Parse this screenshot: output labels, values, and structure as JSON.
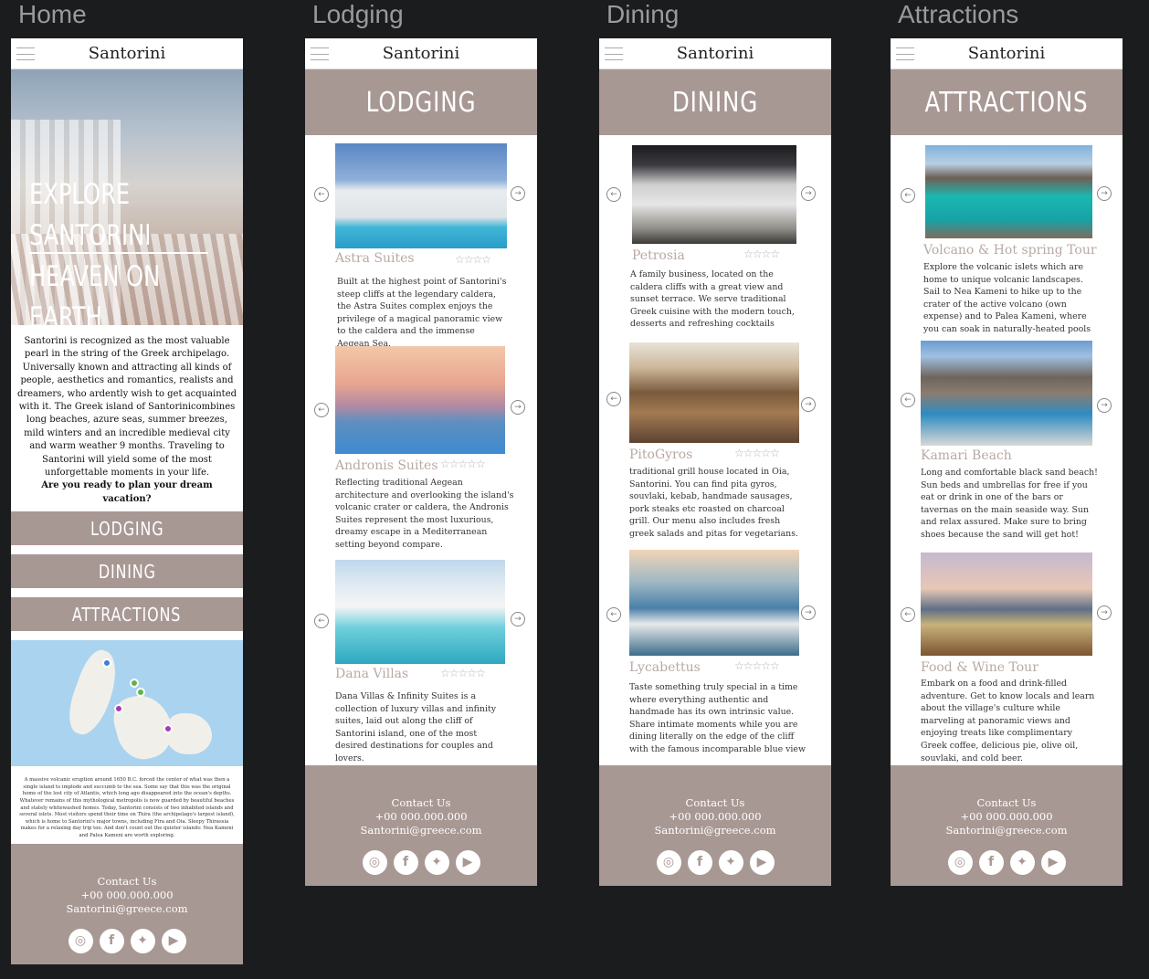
{
  "boards": {
    "home_label": "Home",
    "lodging_label": "Lodging",
    "dining_label": "Dining",
    "attractions_label": "Attractions"
  },
  "site": {
    "title": "Santorini"
  },
  "home": {
    "hero": [
      "EXPLORE",
      "SANTORINI",
      "HEAVEN ON EARTH"
    ],
    "intro": "Santorini is recognized as the most valuable pearl in the string of the Greek archipelago. Universally known and attracting all kinds of people, aesthetics and romantics, realists and dreamers, who ardently wish to get acquainted with it. The Greek island of Santorinicombines long  beaches, azure seas, summer breezes, mild winters and an incredible medieval city and warm weather 9 months. Traveling to Santorini will yield some of the most unforgettable moments in your life.",
    "question": "Are you ready to plan your dream vacation?",
    "nav": [
      "LODGING",
      "DINING",
      "ATTRACTIONS"
    ],
    "small_text": "A massive volcanic eruption around 1650 B.C. forced the center of what was then a single island to implode and succumb to the sea. Some say that this was the original home of the lost city of Atlantis, which long ago disappeared into the ocean's depths. Whatever remains of this mythological metropolis is now guarded by beautiful beaches and stately whitewashed homes. Today, Santorini consists of two inhabited islands and several islets. Most visitors spend their time on Thira (the archipelago's largest island), which is home to Santorini's major towns, including Fira and Oia. Sleepy Thirassia makes for a relaxing day trip too. And don't count out the quieter islands: Nea Kameni and Palea Kameni are worth exploring."
  },
  "footer": {
    "contact": "Contact Us",
    "phone": "+00 000.000.000",
    "email": "Santorini@greece.com"
  },
  "lodging": {
    "header": "LODGING",
    "items": [
      {
        "title": "Astra Suites",
        "stars": "☆☆☆☆",
        "desc": "Built at the highest point of Santorini's steep cliffs at the legendary caldera, the Astra Suites complex enjoys the privilege of a magical panoramic view to the caldera and the immense Aegean Sea."
      },
      {
        "title": "Andronis Suites",
        "stars": "☆☆☆☆☆",
        "desc": "Reflecting traditional Aegean architecture and overlooking the island's volcanic crater or caldera, the Andronis Suites represent the most luxurious, dreamy escape in a Mediterranean setting beyond compare."
      },
      {
        "title": "Dana Villas",
        "stars": "☆☆☆☆☆",
        "desc": "Dana Villas & Infinity Suites is a collection of luxury villas and infinity suites, laid out along the cliff of Santorini island, one of the most desired destinations for couples and lovers."
      }
    ]
  },
  "dining": {
    "header": "DINING",
    "items": [
      {
        "title": "Petrosia",
        "stars": "☆☆☆☆",
        "desc": "A family business, located on the caldera cliffs with a great view and sunset terrace. We serve traditional Greek cuisine with the modern touch, desserts and refreshing cocktails"
      },
      {
        "title": "PitoGyros",
        "stars": "☆☆☆☆☆",
        "desc": "traditional grill house located in Oia, Santorini. You can find pita gyros, souvlaki, kebab, handmade sausages, pork steaks etc roasted on charcoal grill. Our menu also includes fresh greek salads and pitas for vegetarians."
      },
      {
        "title": "Lycabettus",
        "stars": "☆☆☆☆☆",
        "desc": "Taste something truly special in a time where everything authentic and handmade has its own intrinsic value. Share intimate moments while you are dining literally on the edge of the cliff with the famous incomparable blue view"
      }
    ]
  },
  "attractions": {
    "header": "ATTRACTIONS",
    "items": [
      {
        "title": "Volcano & Hot spring Tour",
        "desc": "Explore the volcanic islets which are home to unique volcanic landscapes. Sail to Nea Kameni to hike up to the crater of the active volcano (own expense) and to Palea Kameni, where you can soak in naturally-heated pools"
      },
      {
        "title": "Kamari Beach",
        "desc": "Long and comfortable black sand beach! Sun beds and umbrellas for free if you eat or drink in one of the bars or tavernas on the main seaside way. Sun and relax assured. Make sure to bring shoes because the sand will get hot!"
      },
      {
        "title": "Food & Wine Tour",
        "desc": "Embark on a food and drink-filled adventure. Get to know locals and learn about the village's culture while marveling at panoramic views and enjoying treats like complimentary Greek coffee, delicious pie, olive oil, souvlaki, and cold beer."
      }
    ]
  },
  "icons": {
    "instagram": "instagram-icon",
    "facebook": "facebook-icon",
    "twitter": "twitter-icon",
    "youtube": "youtube-icon"
  },
  "colors": {
    "accent": "#a89894",
    "title_pink": "#b9a9a4",
    "background": "#1b1c1e"
  }
}
